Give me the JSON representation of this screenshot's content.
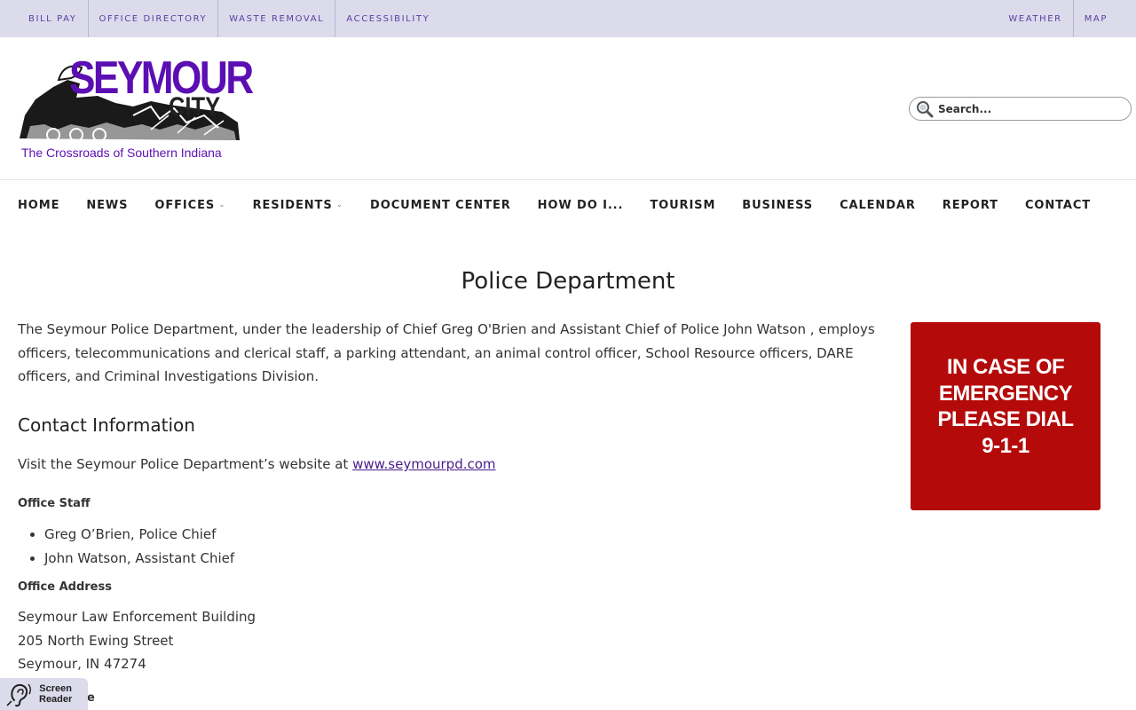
{
  "utility_nav": {
    "left": [
      "BILL PAY",
      "OFFICE DIRECTORY",
      "WASTE REMOVAL",
      "ACCESSIBILITY"
    ],
    "right": [
      "WEATHER",
      "MAP"
    ]
  },
  "logo": {
    "title": "SEYMOUR",
    "subtitle": "CITY",
    "tagline": "The Crossroads of Southern Indiana"
  },
  "search": {
    "placeholder": "Search..."
  },
  "main_nav": {
    "items": [
      {
        "label": "HOME",
        "dropdown": false
      },
      {
        "label": "NEWS",
        "dropdown": false
      },
      {
        "label": "OFFICES",
        "dropdown": true
      },
      {
        "label": "RESIDENTS",
        "dropdown": true
      },
      {
        "label": "DOCUMENT CENTER",
        "dropdown": false
      },
      {
        "label": "HOW DO I...",
        "dropdown": false
      },
      {
        "label": "TOURISM",
        "dropdown": false
      },
      {
        "label": "BUSINESS",
        "dropdown": false
      },
      {
        "label": "CALENDAR",
        "dropdown": false
      },
      {
        "label": "REPORT",
        "dropdown": false
      },
      {
        "label": "CONTACT",
        "dropdown": false
      }
    ]
  },
  "page": {
    "title": "Police Department",
    "intro": "The Seymour Police Department, under the leadership of Chief Greg O'Brien and Assistant Chief of Police John Watson , employs officers, telecommunications and clerical staff, a parking attendant, an animal control officer, School Resource officers, DARE officers, and Criminal Investigations Division.",
    "contact_heading": "Contact Information",
    "visit_text": "Visit the Seymour Police Department’s website at ",
    "visit_link": "www.seymourpd.com",
    "staff_label": "Office Staff",
    "staff": [
      "Greg O’Brien, Police Chief",
      "John Watson, Assistant Chief"
    ],
    "address_label": "Office Address",
    "address": [
      "Seymour Law Enforcement Building",
      "205 North Ewing Street",
      "Seymour, IN 47274"
    ],
    "phone_label_partial": "e"
  },
  "emergency": {
    "text": "IN CASE OF EMERGENCY PLEASE DIAL 9-1-1"
  },
  "screen_reader": {
    "line1": "Screen",
    "line2": "Reader"
  },
  "colors": {
    "utility_bg": "#dcdbec",
    "utility_link": "#5b3ea0",
    "brand_purple": "#5b0fb3",
    "emergency_red": "#b40a0a",
    "link": "#4a1c8c"
  }
}
